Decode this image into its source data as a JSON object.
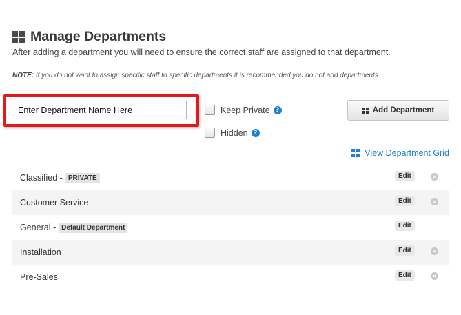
{
  "header": {
    "title": "Manage Departments",
    "icon": "grid-icon",
    "subtitle": "After adding a department you will need to ensure the correct staff are assigned to that department.",
    "note_label": "NOTE:",
    "note_text": " If you do not want to assign specific staff to specific departments it is recommended you do not add departments."
  },
  "form": {
    "name_input_value": "Enter Department Name Here",
    "keep_private_label": "Keep Private",
    "hidden_label": "Hidden",
    "add_button_label": "Add Department",
    "highlight_color": "#e21a1a"
  },
  "view_grid_link": "View Department Grid",
  "departments": [
    {
      "name": "Classified -",
      "badge": "PRIVATE",
      "edit": "Edit",
      "removable": true
    },
    {
      "name": "Customer Service",
      "badge": "",
      "edit": "Edit",
      "removable": true
    },
    {
      "name": "General -",
      "badge": "Default Department",
      "edit": "Edit",
      "removable": false
    },
    {
      "name": "Installation",
      "badge": "",
      "edit": "Edit",
      "removable": true
    },
    {
      "name": "Pre-Sales",
      "badge": "",
      "edit": "Edit",
      "removable": true
    }
  ],
  "colors": {
    "link": "#1e7fd4",
    "highlight": "#e21a1a"
  }
}
